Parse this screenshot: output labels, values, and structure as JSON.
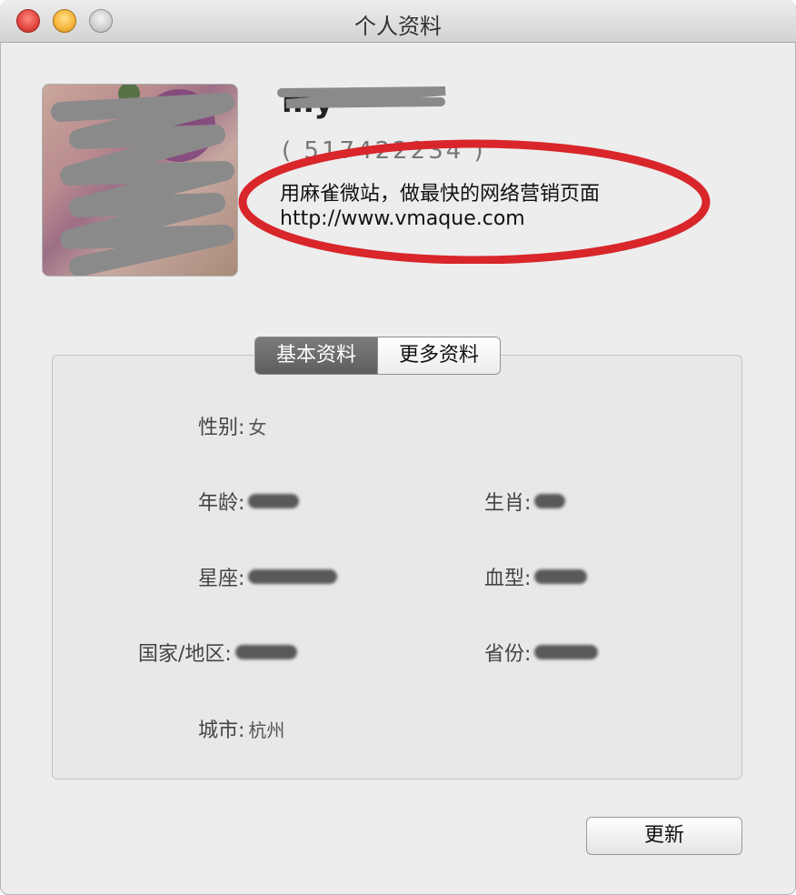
{
  "window": {
    "title": "个人资料"
  },
  "profile": {
    "nickname": "my",
    "qq_number": "( 517422234 )",
    "signature_line1": "用麻雀微站，做最快的网络营销页面",
    "signature_line2": "http://www.vmaque.com"
  },
  "tabs": [
    {
      "label": "基本资料",
      "active": true
    },
    {
      "label": "更多资料",
      "active": false
    }
  ],
  "fields": {
    "gender": {
      "label": "性别:",
      "value": "女"
    },
    "age": {
      "label": "年龄:",
      "value": ""
    },
    "zodiac": {
      "label": "生肖:",
      "value": ""
    },
    "constellation": {
      "label": "星座:",
      "value": ""
    },
    "blood_type": {
      "label": "血型:",
      "value": ""
    },
    "country": {
      "label": "国家/地区:",
      "value": ""
    },
    "province": {
      "label": "省份:",
      "value": ""
    },
    "city": {
      "label": "城市:",
      "value": "杭州"
    }
  },
  "update_button": {
    "label": "更新"
  },
  "colors": {
    "annotation_red": "#d8262b",
    "scribble_gray": "#8a8a8a"
  }
}
